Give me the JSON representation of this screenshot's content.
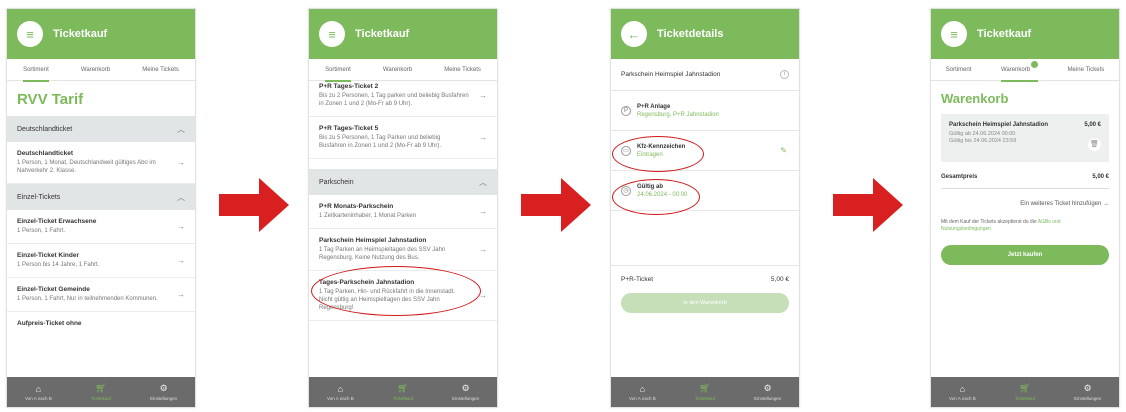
{
  "colors": {
    "brand_green": "#7dba5c",
    "arrow_red": "#d82020",
    "section_gray": "#e1e5e6",
    "bottom_nav": "#6b6b6b"
  },
  "tabs": {
    "sortiment": "Sortiment",
    "warenkorb": "Warenkorb",
    "meine_tickets": "Meine Tickets"
  },
  "bottom_nav": {
    "home": "Von A nach B",
    "ticketkauf": "Ticketkauf",
    "einstellungen": "Einstellungen"
  },
  "screen1": {
    "title": "Ticketkauf",
    "heading": "RVV Tarif",
    "sections": [
      {
        "label": "Deutschlandticket",
        "items": [
          {
            "name": "Deutschlandticket",
            "desc": "1 Person, 1 Monat, Deutschlandweit gültiges Abo im Nahverkehr 2. Klasse."
          }
        ]
      },
      {
        "label": "Einzel-Tickets",
        "items": [
          {
            "name": "Einzel-Ticket Erwachsene",
            "desc": "1 Person, 1 Fahrt."
          },
          {
            "name": "Einzel-Ticket Kinder",
            "desc": "1 Person bis 14 Jahre, 1 Fahrt."
          },
          {
            "name": "Einzel-Ticket Gemeinde",
            "desc": "1 Person, 1 Fahrt, Nur in teilnehmenden Kommunen."
          },
          {
            "name": "Aufpreis-Ticket ohne",
            "desc": ""
          }
        ]
      }
    ]
  },
  "screen2": {
    "title": "Ticketkauf",
    "items_top": [
      {
        "name": "P+R Tages-Ticket 2",
        "desc": "Bis zu 2 Personen, 1 Tag parken und beliebig Busfahren in Zonen 1 und 2 (Mo-Fr ab 9 Uhr)."
      },
      {
        "name": "P+R Tages-Ticket 5",
        "desc": "Bis zu 5 Personen, 1 Tag Parken und beliebig Busfahren in Zonen 1 und 2 (Mo-Fr ab 9 Uhr)."
      }
    ],
    "section": "Parkschein",
    "items_park": [
      {
        "name": "P+R Monats-Parkschein",
        "desc": "1 Zeitkarteninhaber, 1 Monat Parken"
      },
      {
        "name": "Parkschein Heimspiel Jahnstadion",
        "desc": "1 Tag Parken an Heimspieltagen des SSV Jahn Regensburg. Keine Nutzung des Bus."
      },
      {
        "name": "Tages-Parkschein Jahnstadion",
        "desc": "1 Tag Parken, Hin- und Rückfahrt in die Innenstadt. Nicht gültig an Heimspieltagen des SSV Jahn Regensburg!"
      }
    ]
  },
  "screen3": {
    "title": "Ticketdetails",
    "ticket_name": "Parkschein Heimspiel Jahnstadion",
    "rows": [
      {
        "label": "P+R Anlage",
        "value": "Regensburg, P+R Jahnstadion"
      },
      {
        "label": "Kfz-Kennzeichen",
        "value": "Eintragen"
      },
      {
        "label": "Gültig ab",
        "value": "24.06.2024 - 00:00"
      }
    ],
    "price_label": "P+R-Ticket",
    "price": "5,00 €",
    "button": "In den Warenkorb"
  },
  "screen4": {
    "title": "Ticketkauf",
    "heading": "Warenkorb",
    "cart_item": {
      "name": "Parkschein Heimspiel Jahnstadion",
      "price": "5,00 €",
      "valid_from": "Gültig ab 24.06.2024 00:00",
      "valid_to": "Gültig bis 24.06.2024 23:59"
    },
    "total_label": "Gesamtpreis",
    "total_value": "5,00 €",
    "add_more": "Ein weiteres Ticket hinzufügen",
    "agb_prefix": "Mit dem Kauf der Tickets akzeptierst du die",
    "agb_link": "AGBs und Nutzungsbedingungen",
    "buy_button": "Jetzt kaufen"
  }
}
